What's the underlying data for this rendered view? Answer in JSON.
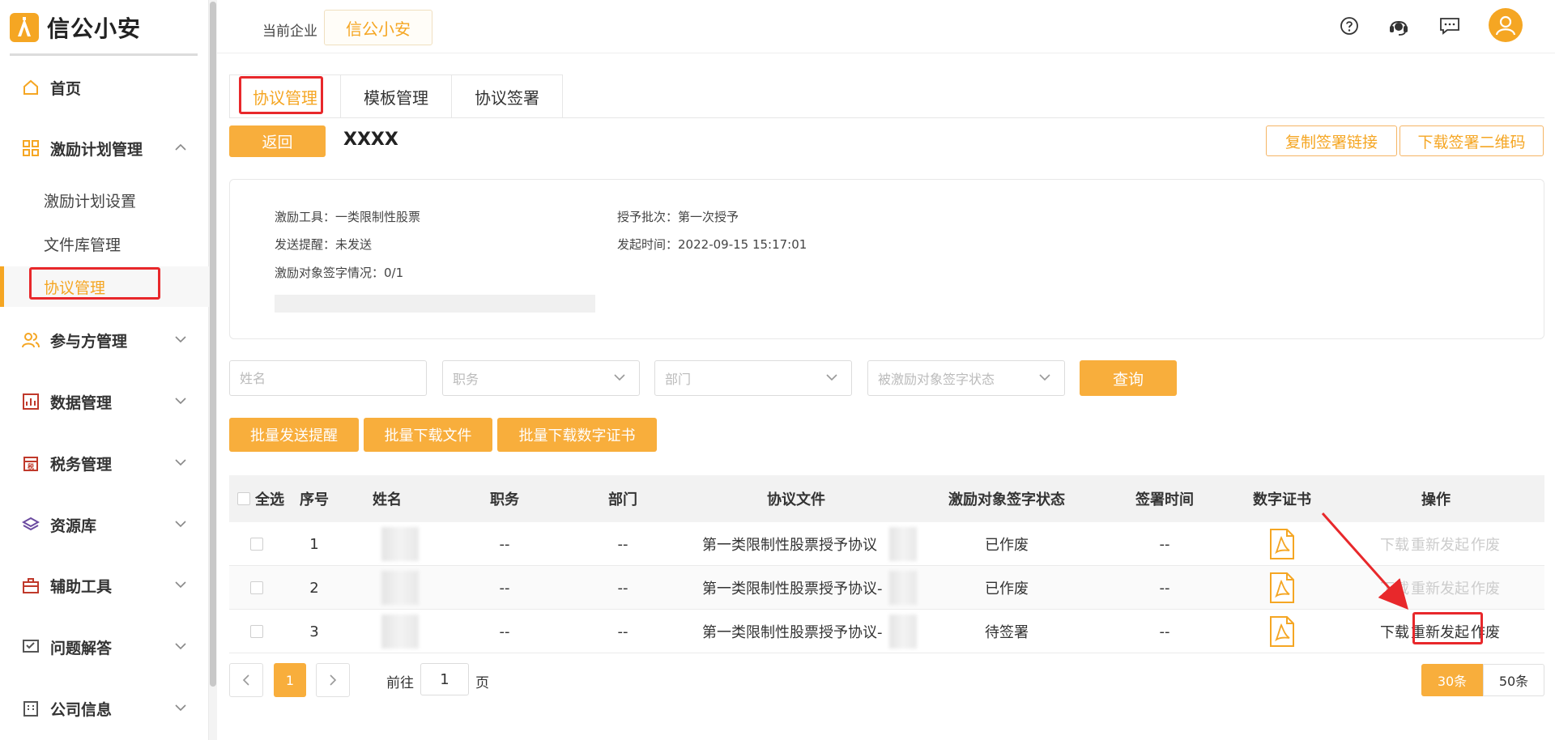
{
  "brand": {
    "name": "信公小安",
    "accent": "#f5a623"
  },
  "sidebar": {
    "items": [
      {
        "label": "首页",
        "icon": "home-icon"
      },
      {
        "label": "激励计划管理",
        "icon": "grid-icon",
        "expanded": true,
        "children": [
          {
            "label": "激励计划设置"
          },
          {
            "label": "文件库管理"
          },
          {
            "label": "协议管理",
            "active": true
          }
        ]
      },
      {
        "label": "参与方管理",
        "icon": "users-icon"
      },
      {
        "label": "数据管理",
        "icon": "chart-icon"
      },
      {
        "label": "税务管理",
        "icon": "tax-icon"
      },
      {
        "label": "资源库",
        "icon": "layers-icon"
      },
      {
        "label": "辅助工具",
        "icon": "toolbox-icon"
      },
      {
        "label": "问题解答",
        "icon": "qa-icon"
      },
      {
        "label": "公司信息",
        "icon": "building-icon"
      }
    ]
  },
  "topbar": {
    "enterprise_label": "当前企业",
    "enterprise_name": "信公小安"
  },
  "tabs": [
    {
      "label": "协议管理",
      "active": true
    },
    {
      "label": "模板管理"
    },
    {
      "label": "协议签署"
    }
  ],
  "header": {
    "back_label": "返回",
    "title": "XXXX",
    "copy_link_label": "复制签署链接",
    "download_qr_label": "下载签署二维码"
  },
  "info": {
    "tool_label": "激励工具：",
    "tool_value": "一类限制性股票",
    "batch_label": "授予批次：",
    "batch_value": "第一次授予",
    "remind_label": "发送提醒：",
    "remind_value": "未发送",
    "time_label": "发起时间：",
    "time_value": "2022-09-15 15:17:01",
    "sign_label": "激励对象签字情况：",
    "sign_value": "0/1"
  },
  "filters": {
    "name_placeholder": "姓名",
    "position_placeholder": "职务",
    "dept_placeholder": "部门",
    "status_placeholder": "被激励对象签字状态",
    "query_label": "查询"
  },
  "batch": {
    "send_remind": "批量发送提醒",
    "download_files": "批量下载文件",
    "download_certs": "批量下载数字证书"
  },
  "table": {
    "headers": {
      "select_all": "全选",
      "index": "序号",
      "name": "姓名",
      "position": "职务",
      "dept": "部门",
      "file": "协议文件",
      "status": "激励对象签字状态",
      "sign_time": "签署时间",
      "cert": "数字证书",
      "ops": "操作"
    },
    "rows": [
      {
        "index": "1",
        "position": "--",
        "dept": "--",
        "file": "第一类限制性股票授予协议",
        "status": "已作废",
        "sign_time": "--",
        "op_download": "下载",
        "op_relaunch": "重新发起",
        "op_void": "作废"
      },
      {
        "index": "2",
        "position": "--",
        "dept": "--",
        "file": "第一类限制性股票授予协议-",
        "status": "已作废",
        "sign_time": "--",
        "op_download": "下载",
        "op_relaunch": "重新发起",
        "op_void": "作废"
      },
      {
        "index": "3",
        "position": "--",
        "dept": "--",
        "file": "第一类限制性股票授予协议-",
        "status": "待签署",
        "sign_time": "--",
        "op_download": "下载",
        "op_relaunch": "重新发起",
        "op_void": "作废"
      }
    ]
  },
  "pagination": {
    "current": "1",
    "goto_label": "前往",
    "goto_value": "1",
    "page_suffix": "页",
    "size_30": "30条",
    "size_50": "50条"
  }
}
